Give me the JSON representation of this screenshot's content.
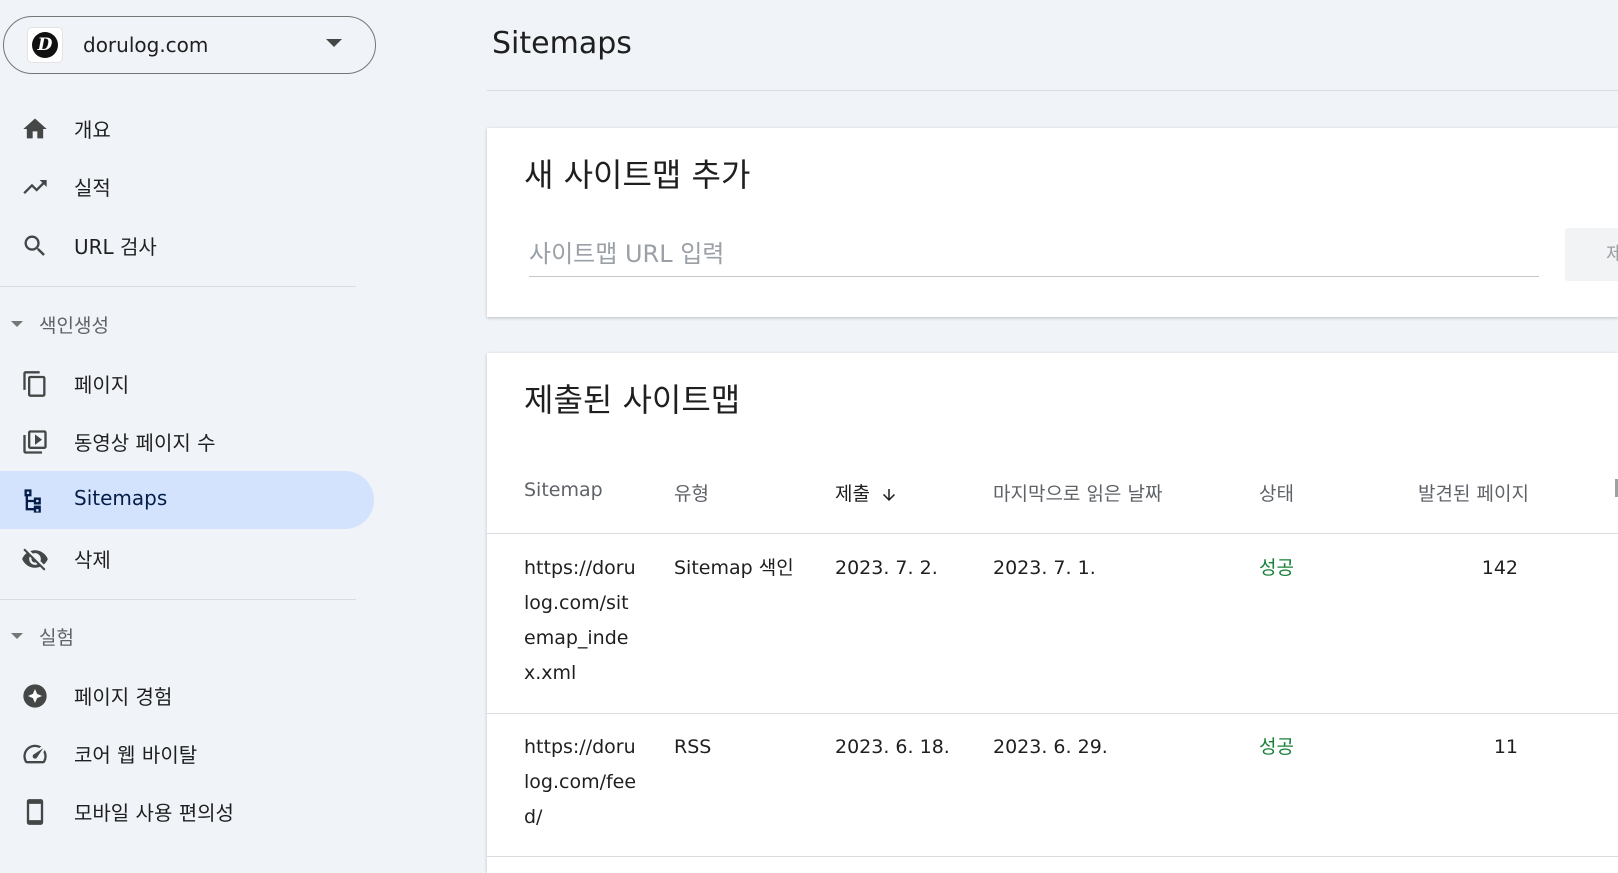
{
  "property": {
    "name": "dorulog.com",
    "logo_letter": "D"
  },
  "nav": {
    "overview": "개요",
    "performance": "실적",
    "url_inspection": "URL 검사",
    "indexing_section": "색인생성",
    "pages": "페이지",
    "video_pages": "동영상 페이지 수",
    "sitemaps": "Sitemaps",
    "removals": "삭제",
    "experience_section": "실험",
    "page_experience": "페이지 경험",
    "core_web_vitals": "코어 웹 바이탈",
    "mobile_usability": "모바일 사용 편의성"
  },
  "main": {
    "page_title": "Sitemaps",
    "add_card": {
      "title": "새 사이트맵 추가",
      "input_placeholder": "사이트맵 URL 입력",
      "submit_label": "제출"
    },
    "submitted_card": {
      "title": "제출된 사이트맵",
      "columns": {
        "sitemap": "Sitemap",
        "type": "유형",
        "submitted": "제출",
        "last_read": "마지막으로 읽은 날짜",
        "status": "상태",
        "discovered_pages": "발견된 페이지"
      },
      "rows": [
        {
          "url": "https://dorulog.com/sitemap_index.xml",
          "type": "Sitemap 색인",
          "submitted": "2023. 7. 2.",
          "last_read": "2023. 7. 1.",
          "status": "성공",
          "discovered": "142"
        },
        {
          "url": "https://dorulog.com/feed/",
          "type": "RSS",
          "submitted": "2023. 6. 18.",
          "last_read": "2023. 6. 29.",
          "status": "성공",
          "discovered": "11"
        }
      ]
    }
  },
  "colors": {
    "active_nav_bg": "#d3e3fd",
    "status_success": "#188038",
    "page_bg": "#f0f4f9"
  }
}
